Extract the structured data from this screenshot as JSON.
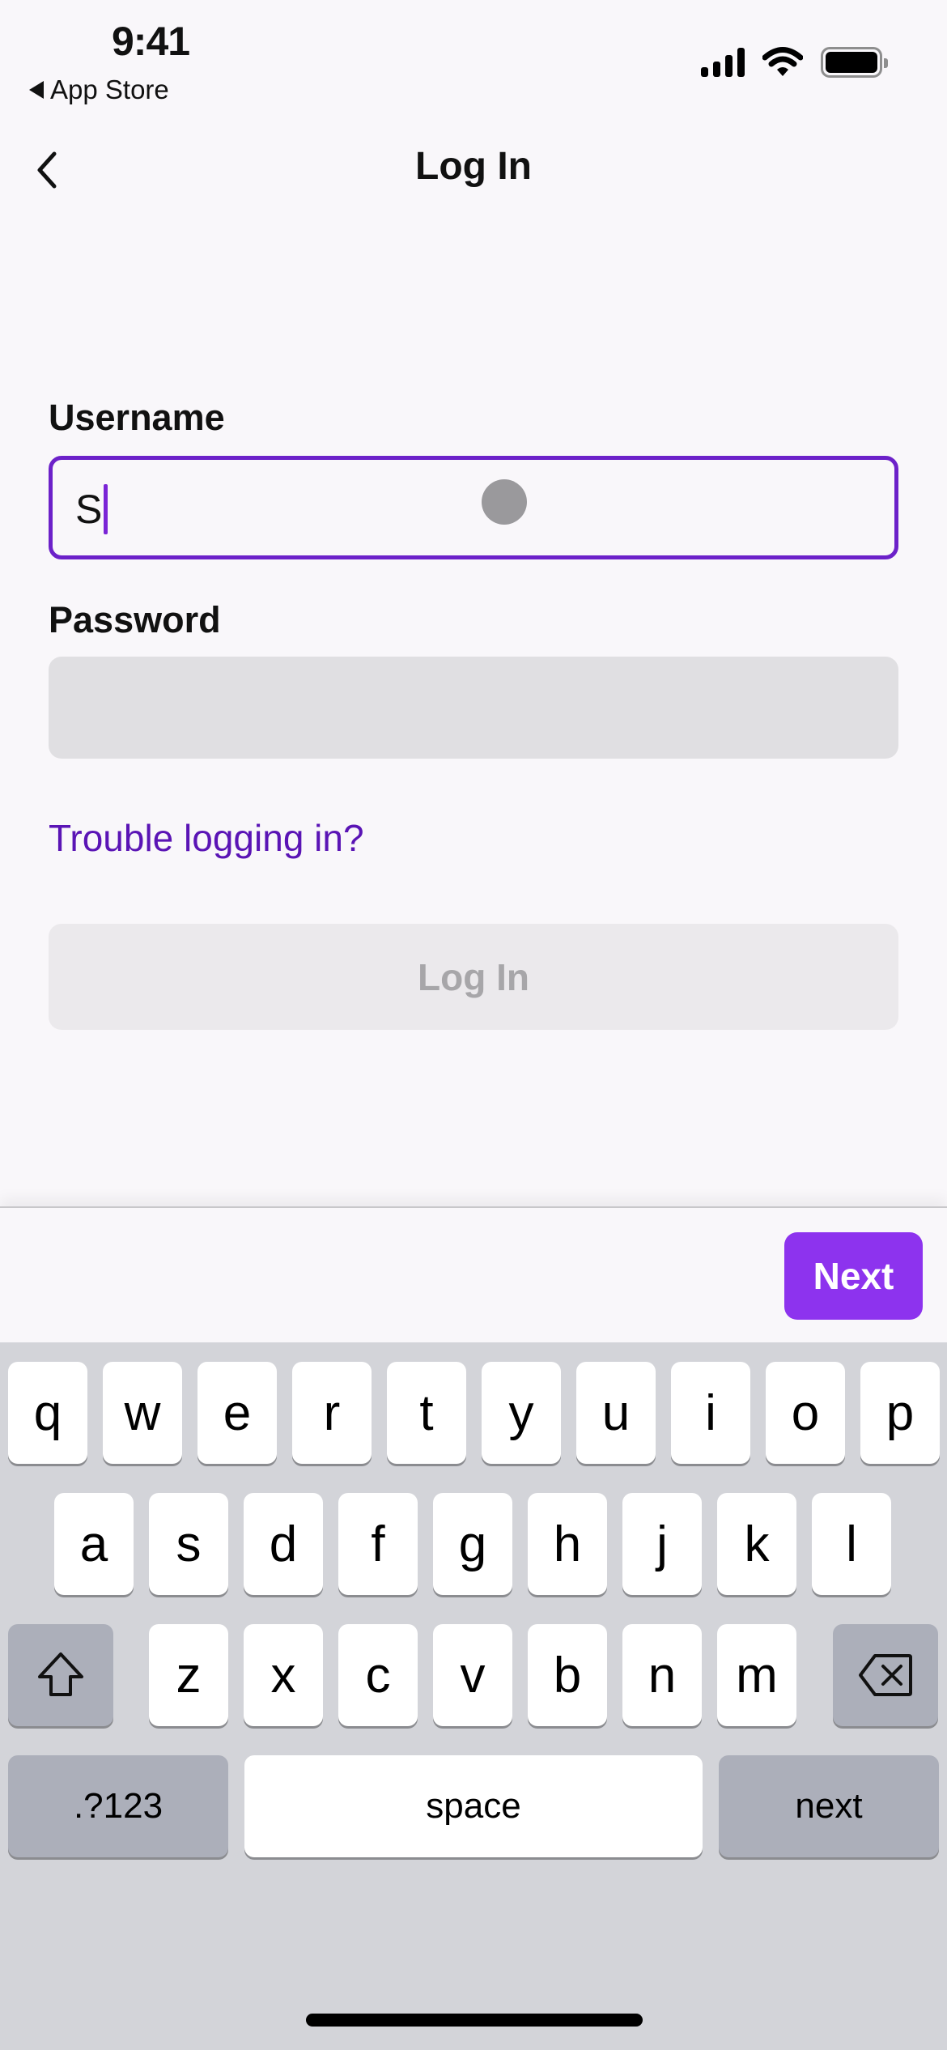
{
  "status_bar": {
    "time": "9:41",
    "back_app": "App Store",
    "icons": [
      "cellular-signal-icon",
      "wifi-icon",
      "battery-icon"
    ]
  },
  "nav": {
    "title": "Log In",
    "back_icon": "chevron-left-icon"
  },
  "form": {
    "username_label": "Username",
    "username_value": "S",
    "password_label": "Password",
    "password_value": "",
    "trouble_link": "Trouble logging in?",
    "login_button": "Log In"
  },
  "accessory": {
    "next_button": "Next"
  },
  "keyboard": {
    "row1": [
      "q",
      "w",
      "e",
      "r",
      "t",
      "y",
      "u",
      "i",
      "o",
      "p"
    ],
    "row2": [
      "a",
      "s",
      "d",
      "f",
      "g",
      "h",
      "j",
      "k",
      "l"
    ],
    "row3": [
      "z",
      "x",
      "c",
      "v",
      "b",
      "n",
      "m"
    ],
    "shift_icon": "shift-icon",
    "delete_icon": "backspace-icon",
    "numbers_key": ".?123",
    "space_key": "space",
    "return_key": "next"
  },
  "colors": {
    "accent": "#8d33ee",
    "focus_border": "#6c21c9",
    "link": "#5a14b5",
    "disabled_button_bg": "#ebe9ec",
    "disabled_button_text": "#a7a6a9",
    "background": "#f9f7fa",
    "keyboard_bg": "#d3d4d9"
  }
}
